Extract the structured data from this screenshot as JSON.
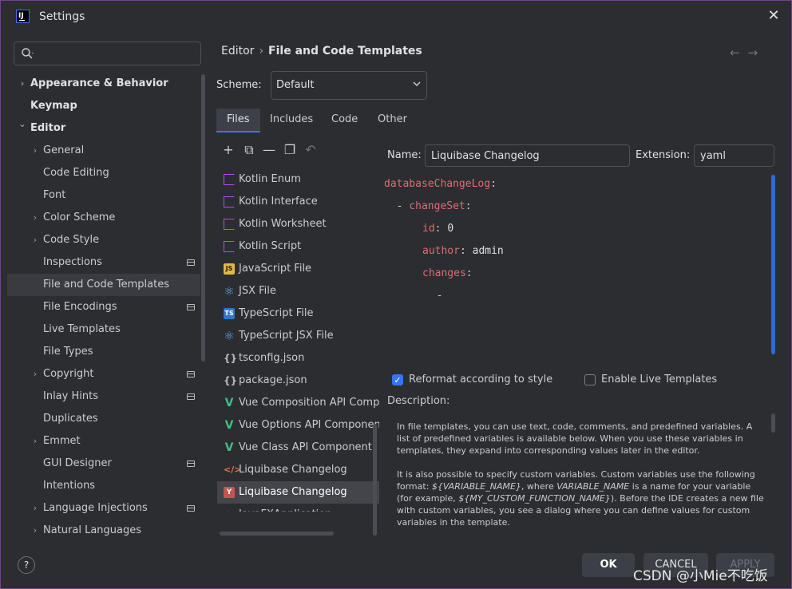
{
  "window": {
    "title": "Settings"
  },
  "search": {
    "placeholder": ""
  },
  "sidebar": {
    "items": [
      {
        "label": "Appearance & Behavior",
        "level": 0,
        "expandable": true,
        "expanded": false
      },
      {
        "label": "Keymap",
        "level": 0,
        "expandable": false
      },
      {
        "label": "Editor",
        "level": 0,
        "expandable": true,
        "expanded": true
      },
      {
        "label": "General",
        "level": 1,
        "expandable": true
      },
      {
        "label": "Code Editing",
        "level": 1,
        "expandable": false
      },
      {
        "label": "Font",
        "level": 1,
        "expandable": false
      },
      {
        "label": "Color Scheme",
        "level": 1,
        "expandable": true
      },
      {
        "label": "Code Style",
        "level": 1,
        "expandable": true
      },
      {
        "label": "Inspections",
        "level": 1,
        "expandable": false,
        "badge": true
      },
      {
        "label": "File and Code Templates",
        "level": 1,
        "expandable": false,
        "selected": true
      },
      {
        "label": "File Encodings",
        "level": 1,
        "expandable": false,
        "badge": true
      },
      {
        "label": "Live Templates",
        "level": 1,
        "expandable": false
      },
      {
        "label": "File Types",
        "level": 1,
        "expandable": false
      },
      {
        "label": "Copyright",
        "level": 1,
        "expandable": true,
        "badge": true
      },
      {
        "label": "Inlay Hints",
        "level": 1,
        "expandable": false,
        "badge": true
      },
      {
        "label": "Duplicates",
        "level": 1,
        "expandable": false
      },
      {
        "label": "Emmet",
        "level": 1,
        "expandable": true
      },
      {
        "label": "GUI Designer",
        "level": 1,
        "expandable": false,
        "badge": true
      },
      {
        "label": "Intentions",
        "level": 1,
        "expandable": false
      },
      {
        "label": "Language Injections",
        "level": 1,
        "expandable": true,
        "badge": true
      },
      {
        "label": "Natural Languages",
        "level": 1,
        "expandable": true
      }
    ]
  },
  "breadcrumb": {
    "parent": "Editor",
    "current": "File and Code Templates",
    "separator": "›"
  },
  "scheme": {
    "label": "Scheme:",
    "value": "Default"
  },
  "tabs": [
    {
      "label": "Files",
      "active": true
    },
    {
      "label": "Includes"
    },
    {
      "label": "Code"
    },
    {
      "label": "Other"
    }
  ],
  "toolbar": {
    "add": "+",
    "copy_template": "⧉",
    "remove": "—",
    "duplicate": "❐",
    "reset": "↶"
  },
  "files": [
    {
      "label": "Kotlin Enum",
      "icon": "kotlin-icon"
    },
    {
      "label": "Kotlin Interface",
      "icon": "kotlin-icon"
    },
    {
      "label": "Kotlin Worksheet",
      "icon": "kotlin-icon"
    },
    {
      "label": "Kotlin Script",
      "icon": "kotlin-icon"
    },
    {
      "label": "JavaScript File",
      "icon": "javascript-icon"
    },
    {
      "label": "JSX File",
      "icon": "react-icon"
    },
    {
      "label": "TypeScript File",
      "icon": "typescript-icon"
    },
    {
      "label": "TypeScript JSX File",
      "icon": "react-icon"
    },
    {
      "label": "tsconfig.json",
      "icon": "json-icon"
    },
    {
      "label": "package.json",
      "icon": "json-icon"
    },
    {
      "label": "Vue Composition API Compo",
      "icon": "vue-icon"
    },
    {
      "label": "Vue Options API Componen",
      "icon": "vue-icon"
    },
    {
      "label": "Vue Class API Component",
      "icon": "vue-icon"
    },
    {
      "label": "Liquibase Changelog",
      "icon": "xml-code-icon"
    },
    {
      "label": "Liquibase Changelog",
      "icon": "liquibase-icon",
      "selected": true
    },
    {
      "label": "JavaFXApplication",
      "icon": "javafx-icon"
    }
  ],
  "form": {
    "name_label": "Name:",
    "name_value": "Liquibase Changelog",
    "extension_label": "Extension:",
    "extension_value": "yaml"
  },
  "code": {
    "lines": [
      {
        "parts": [
          [
            "k",
            "databaseChangeLog"
          ],
          [
            "p",
            ":"
          ]
        ],
        "indent": 0
      },
      {
        "parts": [
          [
            "p",
            "  - "
          ],
          [
            "k",
            "changeSet"
          ],
          [
            "p",
            ":"
          ]
        ],
        "indent": 0
      },
      {
        "parts": [
          [
            "k",
            "id"
          ],
          [
            "p",
            ": "
          ],
          [
            "v",
            "0"
          ]
        ],
        "indent": 6
      },
      {
        "parts": [
          [
            "k",
            "author"
          ],
          [
            "p",
            ": "
          ],
          [
            "v",
            "admin"
          ]
        ],
        "indent": 6
      },
      {
        "parts": [
          [
            "k",
            "changes"
          ],
          [
            "p",
            ":"
          ]
        ],
        "indent": 6
      },
      {
        "parts": [
          [
            "p",
            "  -"
          ]
        ],
        "indent": 6
      }
    ]
  },
  "options": {
    "reformat_label": "Reformat according to style",
    "reformat_checked": true,
    "live_templates_label": "Enable Live Templates",
    "live_templates_checked": false
  },
  "description": {
    "label": "Description:",
    "p1": "In file templates, you can use text, code, comments, and predefined variables. A list of predefined variables is available below. When you use these variables in templates, they expand into corresponding values later in the editor.",
    "p2_a": "It is also possible to specify custom variables. Custom variables use the following format: ",
    "p2_var1": "${VARIABLE_NAME}",
    "p2_b": ", where ",
    "p2_var2": "VARIABLE_NAME",
    "p2_c": " is a name for your variable (for example, ",
    "p2_var3": "${MY_CUSTOM_FUNCTION_NAME}",
    "p2_d": "). Before the IDE creates a new file with custom variables, you see a dialog where you can define values for custom variables in the template."
  },
  "buttons": {
    "help": "?",
    "ok": "OK",
    "cancel": "CANCEL",
    "apply": "APPLY"
  },
  "watermark": "CSDN @小Mie不吃饭",
  "colors": {
    "accent": "#3574f0",
    "keyword": "#e06c75",
    "window_border": "#7a3f8f"
  }
}
